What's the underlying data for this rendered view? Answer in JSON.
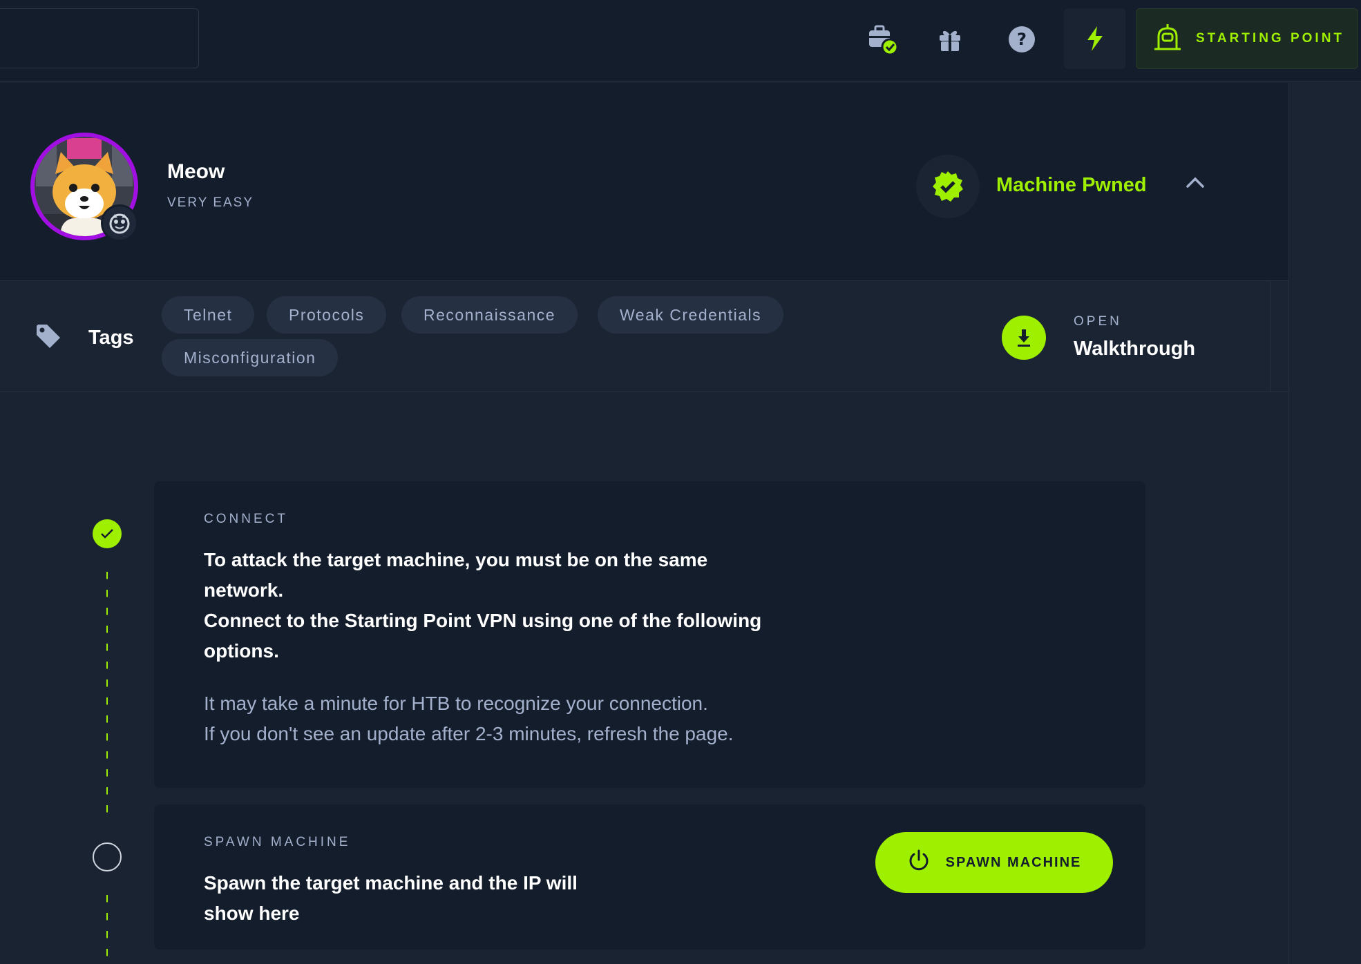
{
  "colors": {
    "accent": "#9fef00",
    "background": "#1a2332",
    "panel": "#141d2b",
    "muted_text": "#a4b1cd",
    "avatar_ring": "#a10fe3"
  },
  "topbar": {
    "search_value": "",
    "icons": [
      "briefcase-check-icon",
      "gift-icon",
      "help-icon",
      "bolt-icon"
    ],
    "starting_point_label": "STARTING POINT"
  },
  "machine": {
    "name": "Meow",
    "difficulty": "VERY EASY",
    "status_label": "Machine Pwned"
  },
  "tags": {
    "label": "Tags",
    "items": [
      "Telnet",
      "Protocols",
      "Reconnaissance",
      "Weak Credentials",
      "Misconfiguration"
    ]
  },
  "walkthrough": {
    "kicker": "OPEN",
    "title": "Walkthrough"
  },
  "steps": {
    "connect": {
      "kicker": "CONNECT",
      "main_line1": "To attack the target machine, you must be on the same",
      "main_line2": "network.",
      "main_line3": "Connect to the Starting Point VPN using one of the following",
      "main_line4": "options.",
      "sub_line1": "It may take a minute for HTB to recognize your connection.",
      "sub_line2": "If you don't see an update after 2-3 minutes, refresh the page."
    },
    "spawn": {
      "kicker": "SPAWN MACHINE",
      "main_line1": "Spawn the target machine and the IP will",
      "main_line2": "show here",
      "button_label": "SPAWN MACHINE"
    }
  }
}
